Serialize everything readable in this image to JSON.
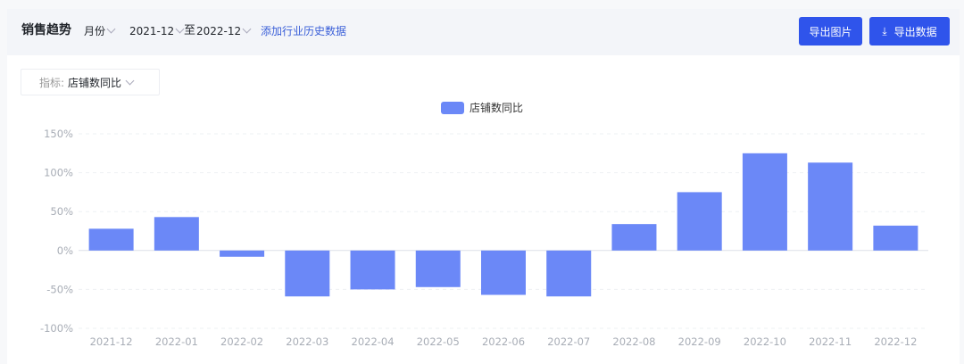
{
  "header": {
    "title": "销售趋势",
    "period": "月份",
    "start": "2021-12",
    "to": "至",
    "end": "2022-12",
    "add_link": "添加行业历史数据",
    "export_image": "导出图片",
    "export_data": "导出数据"
  },
  "metric": {
    "label": "指标:",
    "value": "店铺数同比"
  },
  "colors": {
    "bar": "#6b88f7",
    "button": "#2f54eb"
  },
  "chart_data": {
    "type": "bar",
    "title": "",
    "xlabel": "",
    "ylabel": "",
    "legend": [
      "店铺数同比"
    ],
    "legend_position": "top-center",
    "categories": [
      "2021-12",
      "2022-01",
      "2022-02",
      "2022-03",
      "2022-04",
      "2022-05",
      "2022-06",
      "2022-07",
      "2022-08",
      "2022-09",
      "2022-10",
      "2022-11",
      "2022-12"
    ],
    "series": [
      {
        "name": "店铺数同比",
        "values": [
          28,
          43,
          -8,
          -59,
          -50,
          -47,
          -57,
          -59,
          34,
          75,
          125,
          113,
          32
        ]
      }
    ],
    "ylim": [
      -100,
      150
    ],
    "yticks": [
      150,
      100,
      50,
      0,
      -50,
      -100
    ],
    "ytick_labels": [
      "150%",
      "100%",
      "50%",
      "0%",
      "-50%",
      "-100%"
    ],
    "grid": true
  }
}
